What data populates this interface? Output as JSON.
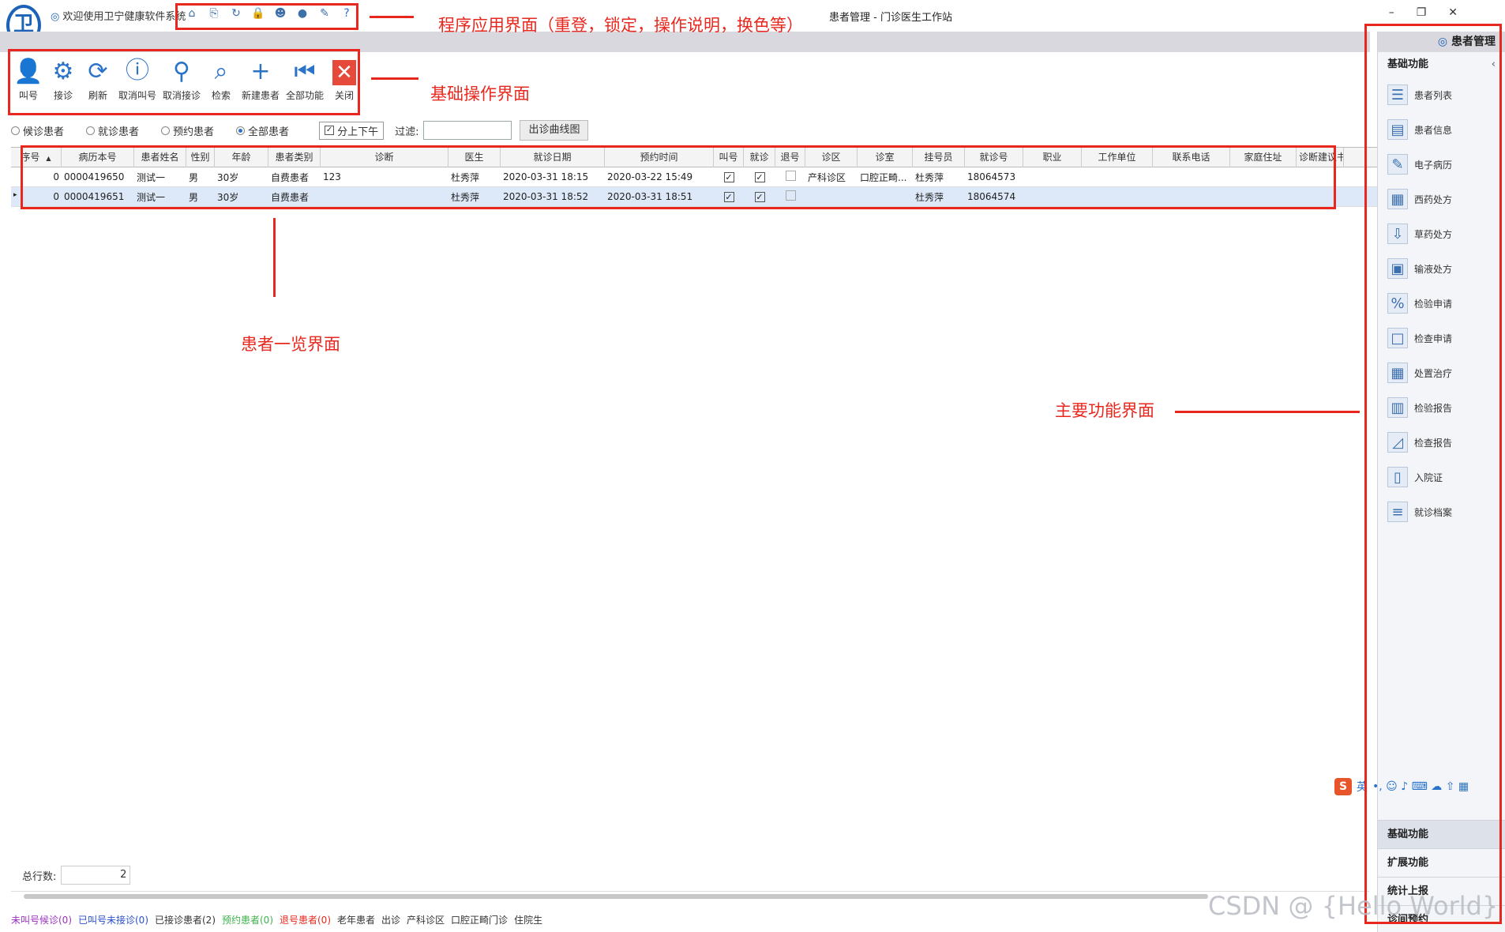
{
  "window": {
    "welcome": "欢迎使用卫宁健康软件系统",
    "title": "患者管理 - 门诊医生工作站",
    "controls": [
      "–",
      "❐",
      "✕"
    ]
  },
  "quick_access": [
    {
      "icon": "home-icon",
      "glyph": "⌂"
    },
    {
      "icon": "relogin-icon",
      "glyph": "⎘"
    },
    {
      "icon": "refresh-icon",
      "glyph": "↻"
    },
    {
      "icon": "lock-icon",
      "glyph": "🔒"
    },
    {
      "icon": "user-icon",
      "glyph": "☻"
    },
    {
      "icon": "theme-icon",
      "glyph": "●"
    },
    {
      "icon": "skin-icon",
      "glyph": "✎"
    },
    {
      "icon": "help-icon",
      "glyph": "?"
    }
  ],
  "toolbar": [
    {
      "label": "叫号",
      "glyph": "👤"
    },
    {
      "label": "接诊",
      "glyph": "⚙"
    },
    {
      "label": "刷新",
      "glyph": "⟳"
    },
    {
      "label": "取消叫号",
      "glyph": "ⓘ"
    },
    {
      "label": "取消接诊",
      "glyph": "⚲"
    },
    {
      "label": "检索",
      "glyph": "⌕"
    },
    {
      "label": "新建患者",
      "glyph": "+"
    },
    {
      "label": "全部功能",
      "glyph": "⏮"
    },
    {
      "label": "关闭",
      "glyph": "✕"
    }
  ],
  "filters": {
    "radios": [
      "候诊患者",
      "就诊患者",
      "预约患者",
      "全部患者"
    ],
    "selected": "全部患者",
    "checkbox_label": "分上下午",
    "filter_label": "过滤:",
    "filter_value": "",
    "curve_button": "出诊曲线图"
  },
  "grid": {
    "columns": [
      "序号",
      "病历本号",
      "患者姓名",
      "性别",
      "年龄",
      "患者类别",
      "诊断",
      "医生",
      "就诊日期",
      "预约时间",
      "叫号",
      "就诊",
      "退号",
      "诊区",
      "诊室",
      "挂号员",
      "就诊号",
      "职业",
      "工作单位",
      "联系电话",
      "家庭住址",
      "诊断建议书"
    ],
    "sort_indicator": "▲",
    "row_marker": "▸",
    "rows": [
      {
        "seq": "0",
        "record": "0000419650",
        "name": "测试一",
        "sex": "男",
        "age": "30岁",
        "type": "自费患者",
        "diag": "123",
        "doctor": "杜秀萍",
        "visit_date": "2020-03-31 18:15",
        "appt": "2020-03-22 15:49",
        "called": true,
        "visited": true,
        "refund": false,
        "zone": "产科诊区",
        "room": "口腔正畸...",
        "clerk": "杜秀萍",
        "visit_no": "18064573"
      },
      {
        "seq": "0",
        "record": "0000419651",
        "name": "测试一",
        "sex": "男",
        "age": "30岁",
        "type": "自费患者",
        "diag": "",
        "doctor": "杜秀萍",
        "visit_date": "2020-03-31 18:52",
        "appt": "2020-03-31 18:51",
        "called": true,
        "visited": true,
        "refund": false,
        "zone": "",
        "room": "",
        "clerk": "杜秀萍",
        "visit_no": "18064574"
      }
    ]
  },
  "footer": {
    "total_label": "总行数:",
    "total_value": "2",
    "status": [
      {
        "text": "未叫号候诊(0)",
        "color": "#9b30c0"
      },
      {
        "text": "已叫号未接诊(0)",
        "color": "#2a4fd0"
      },
      {
        "text": "已接诊患者(2)",
        "color": "#333333"
      },
      {
        "text": "预约患者(0)",
        "color": "#3cb34a"
      },
      {
        "text": "退号患者(0)",
        "color": "#e8281e"
      },
      {
        "text": "老年患者",
        "color": "#333333"
      },
      {
        "text": "出诊",
        "color": "#333333"
      },
      {
        "text": "产科诊区",
        "color": "#333333"
      },
      {
        "text": "口腔正畸门诊",
        "color": "#333333"
      },
      {
        "text": "住院生",
        "color": "#333333"
      }
    ]
  },
  "right_panel": {
    "header": "患者管理",
    "section": "基础功能",
    "items": [
      {
        "label": "患者列表",
        "icon": "patient-list-icon",
        "glyph": "☰"
      },
      {
        "label": "患者信息",
        "icon": "patient-info-icon",
        "glyph": "▤"
      },
      {
        "label": "电子病历",
        "icon": "emr-icon",
        "glyph": "✎"
      },
      {
        "label": "西药处方",
        "icon": "western-rx-icon",
        "glyph": "▦"
      },
      {
        "label": "草药处方",
        "icon": "herbal-rx-icon",
        "glyph": "⇩"
      },
      {
        "label": "输液处方",
        "icon": "infusion-rx-icon",
        "glyph": "▣"
      },
      {
        "label": "检验申请",
        "icon": "lab-request-icon",
        "glyph": "%"
      },
      {
        "label": "检查申请",
        "icon": "exam-request-icon",
        "glyph": "□"
      },
      {
        "label": "处置治疗",
        "icon": "treatment-icon",
        "glyph": "▦"
      },
      {
        "label": "检验报告",
        "icon": "lab-report-icon",
        "glyph": "▥"
      },
      {
        "label": "检查报告",
        "icon": "exam-report-icon",
        "glyph": "◿"
      },
      {
        "label": "入院证",
        "icon": "admission-icon",
        "glyph": "▯"
      },
      {
        "label": "就诊档案",
        "icon": "visit-archive-icon",
        "glyph": "≡"
      }
    ],
    "bottom_sections": [
      "基础功能",
      "扩展功能",
      "统计上报",
      "诊间预约"
    ]
  },
  "ime": {
    "brand": "S",
    "lang": "英",
    "glyphs": "•, ☺ ♪ ⌨ ☁ ⇧ ▦"
  },
  "annotations": {
    "app_bar": "程序应用界面（重登，锁定，操作说明，换色等）",
    "toolbar": "基础操作界面",
    "patient_list": "患者一览界面",
    "main_functions": "主要功能界面"
  },
  "watermark": "CSDN @ {Hello World}"
}
